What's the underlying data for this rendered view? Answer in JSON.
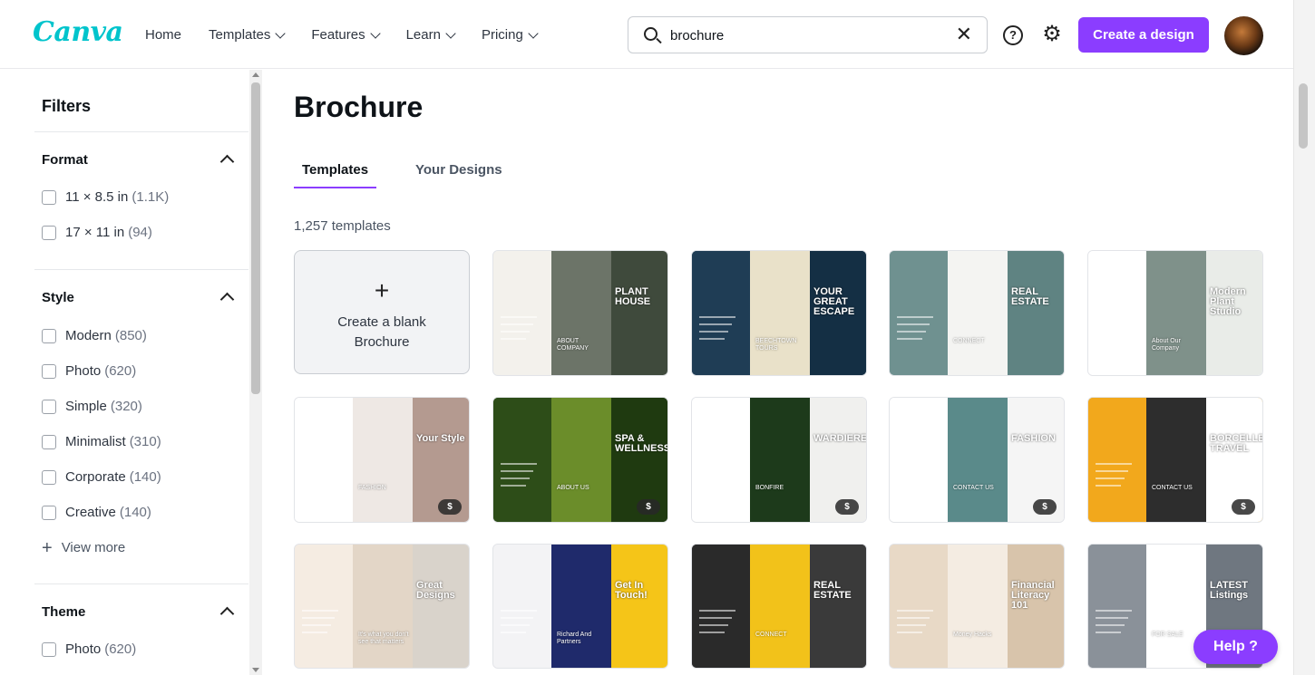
{
  "brand": {
    "logo_text": "Canva",
    "accent": "#8b3dff",
    "logo_color": "#00c4cc"
  },
  "nav": [
    {
      "label": "Home",
      "has_menu": false
    },
    {
      "label": "Templates",
      "has_menu": true
    },
    {
      "label": "Features",
      "has_menu": true
    },
    {
      "label": "Learn",
      "has_menu": true
    },
    {
      "label": "Pricing",
      "has_menu": true
    }
  ],
  "search": {
    "value": "brochure",
    "icon": "search-icon",
    "clear_icon": "close-icon"
  },
  "header_actions": {
    "help_glyph": "?",
    "settings_icon": "gear-icon",
    "create_label": "Create a design"
  },
  "sidebar": {
    "title": "Filters",
    "sections": [
      {
        "title": "Format",
        "options": [
          {
            "label": "11 × 8.5 in",
            "count": "(1.1K)"
          },
          {
            "label": "17 × 11 in",
            "count": "(94)"
          }
        ]
      },
      {
        "title": "Style",
        "options": [
          {
            "label": "Modern",
            "count": "(850)"
          },
          {
            "label": "Photo",
            "count": "(620)"
          },
          {
            "label": "Simple",
            "count": "(320)"
          },
          {
            "label": "Minimalist",
            "count": "(310)"
          },
          {
            "label": "Corporate",
            "count": "(140)"
          },
          {
            "label": "Creative",
            "count": "(140)"
          }
        ],
        "view_more": "View more"
      },
      {
        "title": "Theme",
        "options": [
          {
            "label": "Photo",
            "count": "(620)"
          }
        ]
      }
    ]
  },
  "main": {
    "title": "Brochure",
    "tabs": [
      {
        "label": "Templates",
        "active": true
      },
      {
        "label": "Your Designs",
        "active": false
      }
    ],
    "count_text": "1,257 templates",
    "blank": {
      "label": "Create a blank Brochure"
    },
    "templates": [
      {
        "name": "plant-house",
        "headline": "PLANT HOUSE",
        "sub": "ABOUT COMPANY",
        "colors": [
          "#f3f1ec",
          "#6c7468",
          "#3f4a3c"
        ],
        "paid": false
      },
      {
        "name": "your-great-escape",
        "headline": "YOUR GREAT ESCAPE",
        "sub": "BEECHTOWN TOURS",
        "colors": [
          "#1f3d55",
          "#e9e1c9",
          "#142f44"
        ],
        "paid": false
      },
      {
        "name": "real-estate-connect",
        "headline": "REAL ESTATE",
        "sub": "CONNECT",
        "colors": [
          "#6f9190",
          "#f4f4f2",
          "#5f8382"
        ],
        "paid": false
      },
      {
        "name": "plant-studio",
        "headline": "Modern Plant Studio",
        "sub": "About Our Company",
        "colors": [
          "#ffffff",
          "#7f918a",
          "#e9ece8"
        ],
        "paid": false
      },
      {
        "name": "fashion-your-style",
        "headline": "Your Style",
        "sub": "FASHION",
        "colors": [
          "#ffffff",
          "#eee8e4",
          "#b49a90"
        ],
        "paid": true
      },
      {
        "name": "spa-wellness",
        "headline": "SPA & WELLNESS",
        "sub": "ABOUT US",
        "colors": [
          "#2d4d18",
          "#6b8d2a",
          "#1f3a10"
        ],
        "paid": true
      },
      {
        "name": "wardiere-bonfire",
        "headline": "WARDIERE",
        "sub": "BONFIRE",
        "colors": [
          "#ffffff",
          "#1d3a1b",
          "#f0f0ee"
        ],
        "paid": true
      },
      {
        "name": "fashion-minimalist",
        "headline": "FASHION",
        "sub": "CONTACT US",
        "colors": [
          "#ffffff",
          "#5a8a8a",
          "#f5f5f5"
        ],
        "paid": true
      },
      {
        "name": "borcelle-travel",
        "headline": "BORCELLE TRAVEL",
        "sub": "CONTACT US",
        "colors": [
          "#f2a81c",
          "#2d2d2d",
          "#ffffff"
        ],
        "paid": true
      },
      {
        "name": "great-designs",
        "headline": "Great Designs",
        "sub": "It's what you don't see that matters",
        "colors": [
          "#f5ece2",
          "#e3d6c7",
          "#d9d3cb"
        ],
        "paid": false
      },
      {
        "name": "richard-partners",
        "headline": "Get In Touch!",
        "sub": "Richard And Partners",
        "colors": [
          "#f3f3f5",
          "#1f2a6b",
          "#f5c518"
        ],
        "paid": false
      },
      {
        "name": "real-estate-dark",
        "headline": "REAL ESTATE",
        "sub": "CONNECT",
        "colors": [
          "#2a2a2a",
          "#f2c21a",
          "#3a3a3a"
        ],
        "paid": false
      },
      {
        "name": "financial-literacy",
        "headline": "Financial Literacy 101",
        "sub": "Money Hacks",
        "colors": [
          "#e8d9c6",
          "#f4ece2",
          "#d8c4ab"
        ],
        "paid": false
      },
      {
        "name": "latest-listings",
        "headline": "LATEST Listings",
        "sub": "FOR SALE",
        "colors": [
          "#8a9199",
          "#ffffff",
          "#6f7780"
        ],
        "paid": false
      }
    ]
  },
  "help_button": {
    "label": "Help ?"
  }
}
